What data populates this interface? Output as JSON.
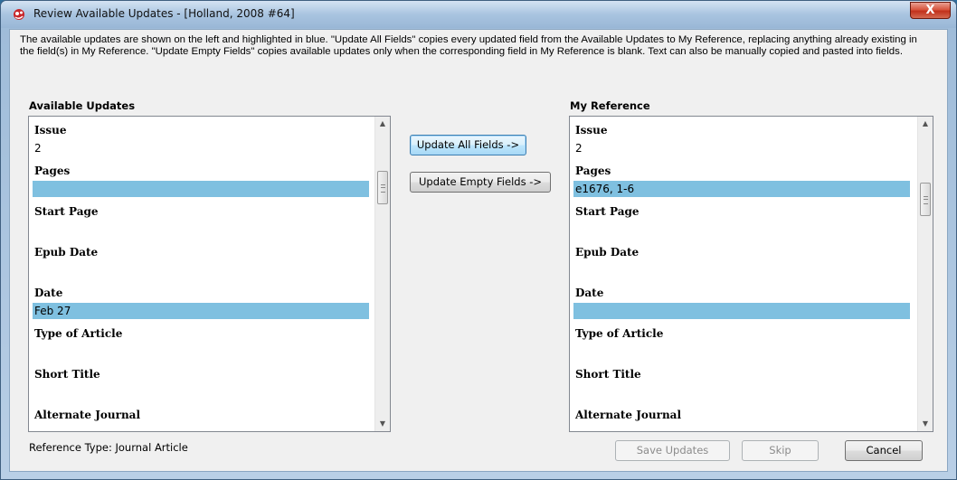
{
  "window": {
    "title": "Review Available Updates - [Holland, 2008 #64]",
    "close_glyph": "X",
    "app_icon": "endnote-icon"
  },
  "intro_text": "The available updates are shown on the left and highlighted in blue. \"Update All Fields\" copies every updated field from the Available Updates to My Reference, replacing anything already existing in the field(s) in My Reference. \"Update Empty Fields\" copies available updates only when the corresponding field in My Reference is blank. Text can also be manually copied and pasted into fields.",
  "available_updates": {
    "label": "Available Updates",
    "fields": [
      {
        "name": "Issue",
        "value": "2",
        "highlight": false
      },
      {
        "name": "Pages",
        "value": "",
        "highlight": true
      },
      {
        "name": "Start Page",
        "value": "",
        "highlight": false
      },
      {
        "name": "Epub Date",
        "value": "",
        "highlight": false
      },
      {
        "name": "Date",
        "value": "Feb 27",
        "highlight": true
      },
      {
        "name": "Type of Article",
        "value": "",
        "highlight": false
      },
      {
        "name": "Short Title",
        "value": "",
        "highlight": false
      },
      {
        "name": "Alternate Journal",
        "value": "",
        "highlight": false
      }
    ]
  },
  "my_reference": {
    "label": "My Reference",
    "fields": [
      {
        "name": "Issue",
        "value": "2",
        "highlight": false
      },
      {
        "name": "Pages",
        "value": "e1676, 1-6",
        "highlight": true
      },
      {
        "name": "Start Page",
        "value": "",
        "highlight": false
      },
      {
        "name": "Epub Date",
        "value": "",
        "highlight": false
      },
      {
        "name": "Date",
        "value": "",
        "highlight": true
      },
      {
        "name": "Type of Article",
        "value": "",
        "highlight": false
      },
      {
        "name": "Short Title",
        "value": "",
        "highlight": false
      },
      {
        "name": "Alternate Journal",
        "value": "",
        "highlight": false
      }
    ]
  },
  "buttons": {
    "update_all": "Update All Fields ->",
    "update_empty": "Update Empty Fields ->",
    "save": "Save Updates",
    "skip": "Skip",
    "cancel": "Cancel"
  },
  "status": {
    "reference_type": "Reference Type: Journal Article"
  },
  "colors": {
    "highlight": "#7fc0e0"
  }
}
